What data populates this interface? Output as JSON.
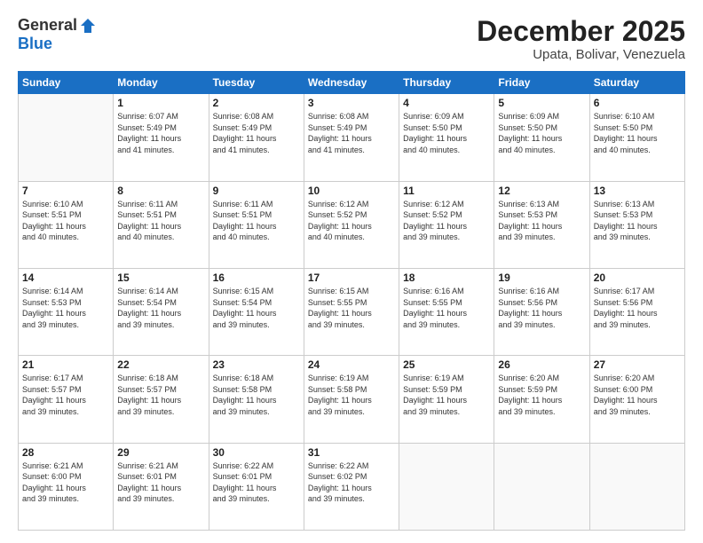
{
  "header": {
    "logo_general": "General",
    "logo_blue": "Blue",
    "month_title": "December 2025",
    "location": "Upata, Bolivar, Venezuela"
  },
  "days_of_week": [
    "Sunday",
    "Monday",
    "Tuesday",
    "Wednesday",
    "Thursday",
    "Friday",
    "Saturday"
  ],
  "weeks": [
    [
      {
        "day": "",
        "info": ""
      },
      {
        "day": "1",
        "info": "Sunrise: 6:07 AM\nSunset: 5:49 PM\nDaylight: 11 hours\nand 41 minutes."
      },
      {
        "day": "2",
        "info": "Sunrise: 6:08 AM\nSunset: 5:49 PM\nDaylight: 11 hours\nand 41 minutes."
      },
      {
        "day": "3",
        "info": "Sunrise: 6:08 AM\nSunset: 5:49 PM\nDaylight: 11 hours\nand 41 minutes."
      },
      {
        "day": "4",
        "info": "Sunrise: 6:09 AM\nSunset: 5:50 PM\nDaylight: 11 hours\nand 40 minutes."
      },
      {
        "day": "5",
        "info": "Sunrise: 6:09 AM\nSunset: 5:50 PM\nDaylight: 11 hours\nand 40 minutes."
      },
      {
        "day": "6",
        "info": "Sunrise: 6:10 AM\nSunset: 5:50 PM\nDaylight: 11 hours\nand 40 minutes."
      }
    ],
    [
      {
        "day": "7",
        "info": "Sunrise: 6:10 AM\nSunset: 5:51 PM\nDaylight: 11 hours\nand 40 minutes."
      },
      {
        "day": "8",
        "info": "Sunrise: 6:11 AM\nSunset: 5:51 PM\nDaylight: 11 hours\nand 40 minutes."
      },
      {
        "day": "9",
        "info": "Sunrise: 6:11 AM\nSunset: 5:51 PM\nDaylight: 11 hours\nand 40 minutes."
      },
      {
        "day": "10",
        "info": "Sunrise: 6:12 AM\nSunset: 5:52 PM\nDaylight: 11 hours\nand 40 minutes."
      },
      {
        "day": "11",
        "info": "Sunrise: 6:12 AM\nSunset: 5:52 PM\nDaylight: 11 hours\nand 39 minutes."
      },
      {
        "day": "12",
        "info": "Sunrise: 6:13 AM\nSunset: 5:53 PM\nDaylight: 11 hours\nand 39 minutes."
      },
      {
        "day": "13",
        "info": "Sunrise: 6:13 AM\nSunset: 5:53 PM\nDaylight: 11 hours\nand 39 minutes."
      }
    ],
    [
      {
        "day": "14",
        "info": "Sunrise: 6:14 AM\nSunset: 5:53 PM\nDaylight: 11 hours\nand 39 minutes."
      },
      {
        "day": "15",
        "info": "Sunrise: 6:14 AM\nSunset: 5:54 PM\nDaylight: 11 hours\nand 39 minutes."
      },
      {
        "day": "16",
        "info": "Sunrise: 6:15 AM\nSunset: 5:54 PM\nDaylight: 11 hours\nand 39 minutes."
      },
      {
        "day": "17",
        "info": "Sunrise: 6:15 AM\nSunset: 5:55 PM\nDaylight: 11 hours\nand 39 minutes."
      },
      {
        "day": "18",
        "info": "Sunrise: 6:16 AM\nSunset: 5:55 PM\nDaylight: 11 hours\nand 39 minutes."
      },
      {
        "day": "19",
        "info": "Sunrise: 6:16 AM\nSunset: 5:56 PM\nDaylight: 11 hours\nand 39 minutes."
      },
      {
        "day": "20",
        "info": "Sunrise: 6:17 AM\nSunset: 5:56 PM\nDaylight: 11 hours\nand 39 minutes."
      }
    ],
    [
      {
        "day": "21",
        "info": "Sunrise: 6:17 AM\nSunset: 5:57 PM\nDaylight: 11 hours\nand 39 minutes."
      },
      {
        "day": "22",
        "info": "Sunrise: 6:18 AM\nSunset: 5:57 PM\nDaylight: 11 hours\nand 39 minutes."
      },
      {
        "day": "23",
        "info": "Sunrise: 6:18 AM\nSunset: 5:58 PM\nDaylight: 11 hours\nand 39 minutes."
      },
      {
        "day": "24",
        "info": "Sunrise: 6:19 AM\nSunset: 5:58 PM\nDaylight: 11 hours\nand 39 minutes."
      },
      {
        "day": "25",
        "info": "Sunrise: 6:19 AM\nSunset: 5:59 PM\nDaylight: 11 hours\nand 39 minutes."
      },
      {
        "day": "26",
        "info": "Sunrise: 6:20 AM\nSunset: 5:59 PM\nDaylight: 11 hours\nand 39 minutes."
      },
      {
        "day": "27",
        "info": "Sunrise: 6:20 AM\nSunset: 6:00 PM\nDaylight: 11 hours\nand 39 minutes."
      }
    ],
    [
      {
        "day": "28",
        "info": "Sunrise: 6:21 AM\nSunset: 6:00 PM\nDaylight: 11 hours\nand 39 minutes."
      },
      {
        "day": "29",
        "info": "Sunrise: 6:21 AM\nSunset: 6:01 PM\nDaylight: 11 hours\nand 39 minutes."
      },
      {
        "day": "30",
        "info": "Sunrise: 6:22 AM\nSunset: 6:01 PM\nDaylight: 11 hours\nand 39 minutes."
      },
      {
        "day": "31",
        "info": "Sunrise: 6:22 AM\nSunset: 6:02 PM\nDaylight: 11 hours\nand 39 minutes."
      },
      {
        "day": "",
        "info": ""
      },
      {
        "day": "",
        "info": ""
      },
      {
        "day": "",
        "info": ""
      }
    ]
  ]
}
